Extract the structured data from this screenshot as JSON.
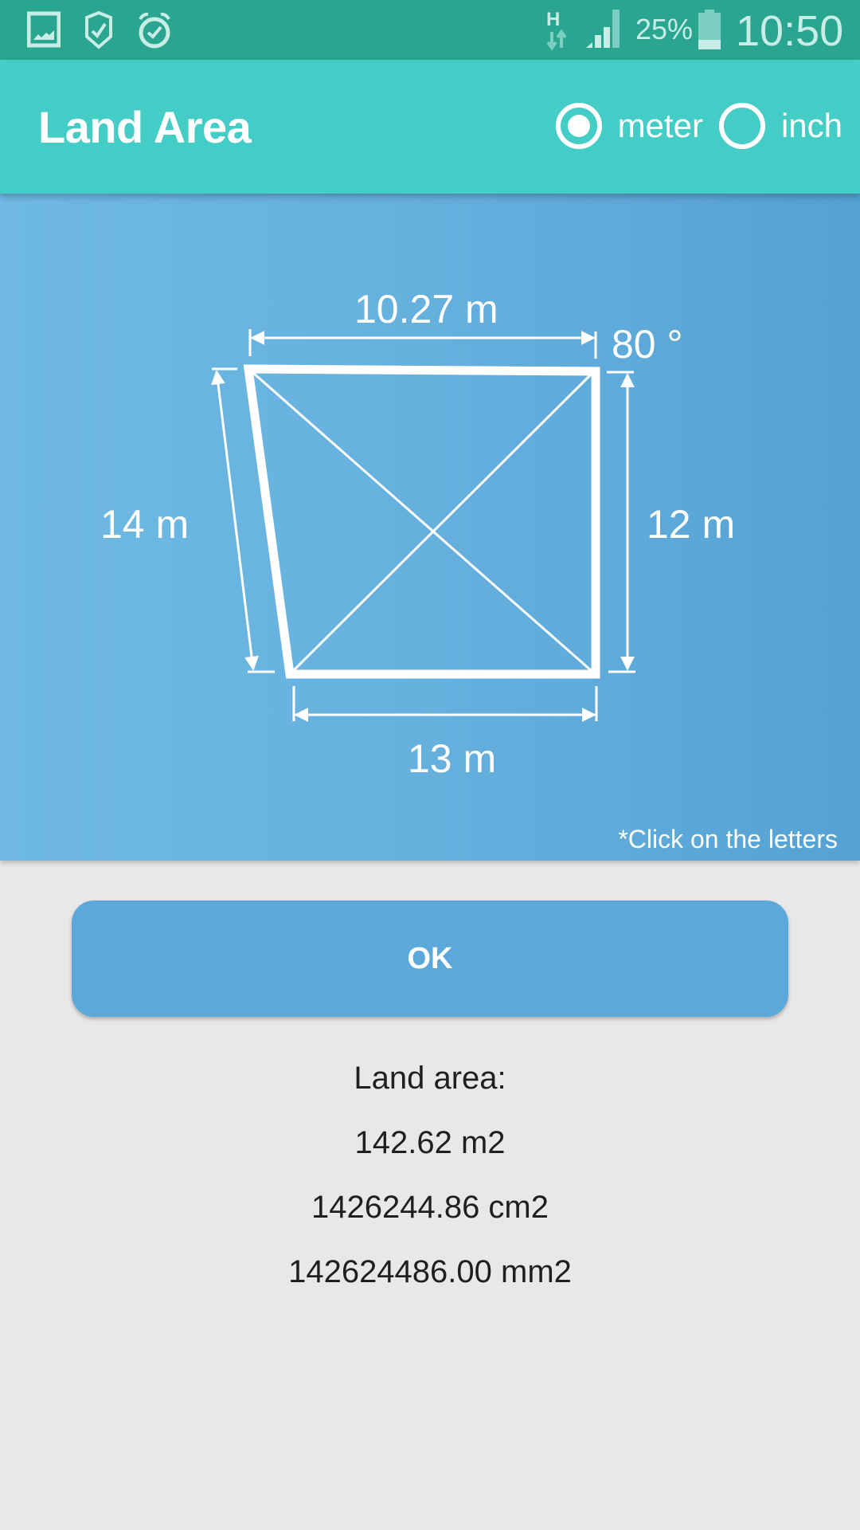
{
  "status_bar": {
    "icons": [
      "gallery-icon",
      "shield-check-icon",
      "alarm-icon",
      "network-h-icon",
      "signal-icon",
      "battery-icon"
    ],
    "battery_percent": "25%",
    "time": "10:50"
  },
  "app_bar": {
    "title": "Land Area",
    "unit_options": [
      {
        "label": "meter",
        "checked": true
      },
      {
        "label": "inch",
        "checked": false
      }
    ]
  },
  "diagram": {
    "top_side": "10.27 m",
    "angle": "80 °",
    "left_side": "14 m",
    "right_side": "12 m",
    "bottom_side": "13 m",
    "hint": "*Click on the letters"
  },
  "ok_button": {
    "label": "OK"
  },
  "results": {
    "heading": "Land area:",
    "m2": "142.62 m2",
    "cm2": "1426244.86 cm2",
    "mm2": "142624486.00 mm2"
  },
  "colors": {
    "status_bar": "#2aa690",
    "app_bar": "#44cdc6",
    "panel": "#66b0de",
    "button": "#5aa9da",
    "background": "#e8e8e8"
  }
}
